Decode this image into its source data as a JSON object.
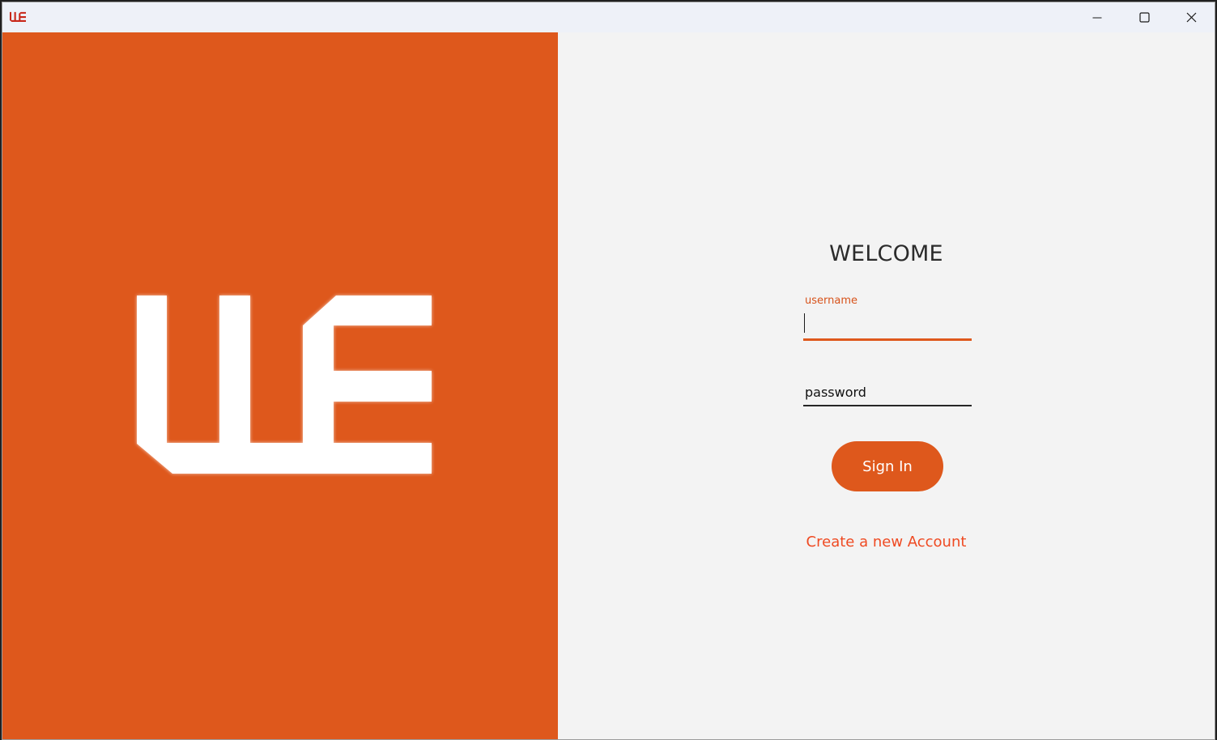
{
  "window": {
    "app_icon": "we-logo-icon",
    "controls": {
      "minimize_icon": "minimize-icon",
      "maximize_icon": "maximize-icon",
      "close_icon": "close-icon"
    }
  },
  "brand": {
    "logo": "we-logo",
    "background_color": "#de581c"
  },
  "login": {
    "title": "WELCOME",
    "username": {
      "label": "username",
      "value": ""
    },
    "password": {
      "placeholder": "password",
      "value": ""
    },
    "sign_in_label": "Sign In",
    "create_account_label": "Create a new Account"
  },
  "colors": {
    "accent": "#de581c",
    "link": "#ef4a22",
    "panel_bg": "#f3f3f3"
  }
}
